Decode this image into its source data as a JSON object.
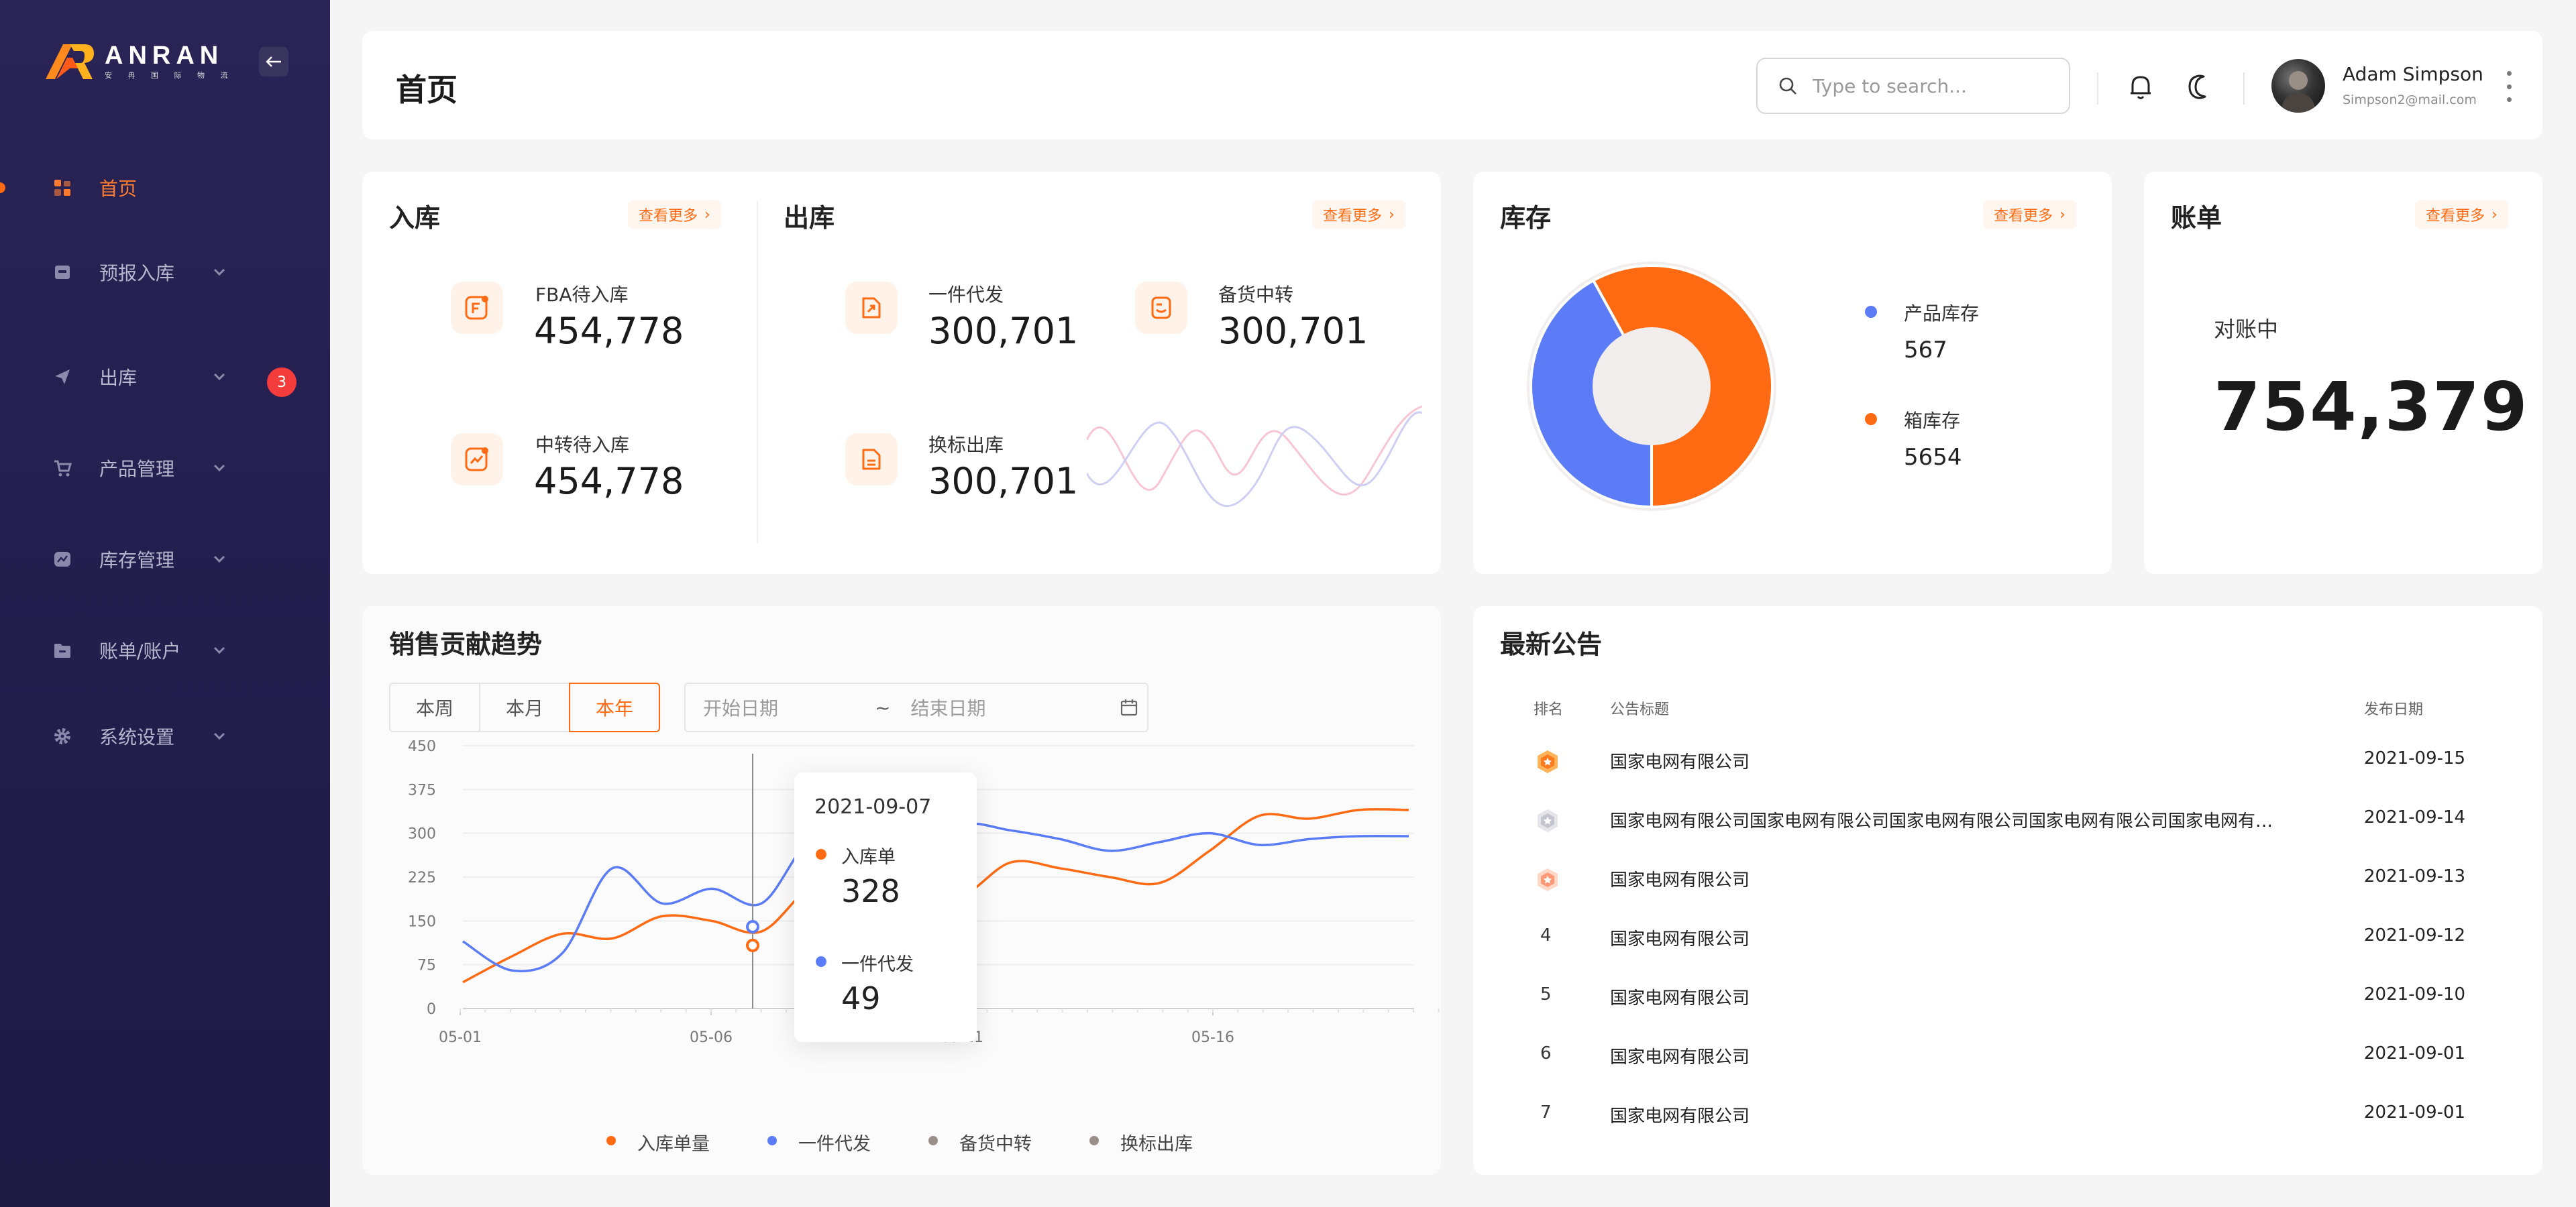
{
  "app": {
    "brand": "ANRAN",
    "brand_sub": "安 冉 国 际 物 流"
  },
  "sidebar": {
    "items": [
      {
        "label": "首页",
        "icon": "dashboard-icon",
        "active": true
      },
      {
        "label": "预报入库",
        "icon": "inbox-icon"
      },
      {
        "label": "出库",
        "icon": "send-icon",
        "badge": "3"
      },
      {
        "label": "产品管理",
        "icon": "cart-icon"
      },
      {
        "label": "库存管理",
        "icon": "chart-box-icon"
      },
      {
        "label": "账单/账户",
        "icon": "folder-icon"
      },
      {
        "label": "系统设置",
        "icon": "gear-icon"
      }
    ]
  },
  "header": {
    "title": "首页",
    "search_placeholder": "Type to search...",
    "user": {
      "name": "Adam Simpson",
      "email": "Simpson2@mail.com"
    }
  },
  "inbound": {
    "title": "入库",
    "more": "查看更多",
    "stats": [
      {
        "label": "FBA待入库",
        "value": "454,778"
      },
      {
        "label": "中转待入库",
        "value": "454,778"
      }
    ]
  },
  "outbound": {
    "title": "出库",
    "more": "查看更多",
    "stats": [
      {
        "label": "一件代发",
        "value": "300,701"
      },
      {
        "label": "备货中转",
        "value": "300,701"
      },
      {
        "label": "换标出库",
        "value": "300,701"
      }
    ]
  },
  "inventory": {
    "title": "库存",
    "more": "查看更多",
    "legend": [
      {
        "label": "产品库存",
        "value": "567",
        "color": "#5b7cf6"
      },
      {
        "label": "箱库存",
        "value": "5654",
        "color": "#ff6a13"
      }
    ]
  },
  "billing": {
    "title": "账单",
    "more": "查看更多",
    "label": "对账中",
    "value": "754,379"
  },
  "sales": {
    "title": "销售贡献趋势",
    "tabs": [
      "本周",
      "本月",
      "本年"
    ],
    "active_tab": "本年",
    "start_placeholder": "开始日期",
    "separator": "~",
    "end_placeholder": "结束日期",
    "tooltip": {
      "date": "2021-09-07",
      "items": [
        {
          "label": "入库单",
          "value": "328",
          "color": "#ff6a13"
        },
        {
          "label": "一件代发",
          "value": "49",
          "color": "#5b7cf6"
        }
      ]
    },
    "legend": [
      {
        "label": "入库单量",
        "color": "#ff6a13"
      },
      {
        "label": "一件代发",
        "color": "#5b7cf6"
      },
      {
        "label": "备货中转",
        "color": "#9a8e8a"
      },
      {
        "label": "换标出库",
        "color": "#9a8e8a"
      }
    ]
  },
  "chart_data": [
    {
      "type": "pie",
      "title": "",
      "categories": [
        "产品库存",
        "箱库存"
      ],
      "values": [
        567,
        5654
      ],
      "colors": [
        "#5b7cf6",
        "#ff6a13"
      ],
      "note": "donut"
    },
    {
      "type": "line",
      "title": "",
      "xlabel": "",
      "ylabel": "",
      "ylim": [
        0,
        450
      ],
      "yticks": [
        0,
        75,
        150,
        225,
        300,
        375,
        450
      ],
      "xticks": [
        "05-01",
        "05-06",
        "05-11",
        "05-16"
      ],
      "x": [
        0,
        1,
        2,
        3,
        4,
        5,
        6,
        7,
        8,
        9,
        10,
        11,
        12,
        13,
        14,
        15,
        16,
        17,
        18,
        19
      ],
      "series": [
        {
          "name": "入库单量",
          "color": "#ff6a13",
          "values": [
            45,
            90,
            128,
            120,
            158,
            150,
            132,
            210,
            235,
            200,
            192,
            250,
            240,
            225,
            215,
            270,
            330,
            325,
            340,
            340
          ]
        },
        {
          "name": "一件代发",
          "color": "#5b7cf6",
          "values": [
            115,
            65,
            95,
            240,
            180,
            205,
            180,
            290,
            280,
            265,
            315,
            305,
            290,
            270,
            285,
            300,
            280,
            290,
            295,
            295
          ]
        }
      ],
      "grid": true,
      "legend": "bottom"
    }
  ],
  "announcements": {
    "title": "最新公告",
    "columns": [
      "排名",
      "公告标题",
      "发布日期"
    ],
    "rows": [
      {
        "rank": "1",
        "title": "国家电网有限公司",
        "date": "2021-09-15",
        "medal": "gold"
      },
      {
        "rank": "2",
        "title": "国家电网有限公司国家电网有限公司国家电网有限公司国家电网有限公司国家电网有…",
        "date": "2021-09-14",
        "medal": "silver"
      },
      {
        "rank": "3",
        "title": "国家电网有限公司",
        "date": "2021-09-13",
        "medal": "bronze"
      },
      {
        "rank": "4",
        "title": "国家电网有限公司",
        "date": "2021-09-12"
      },
      {
        "rank": "5",
        "title": "国家电网有限公司",
        "date": "2021-09-10"
      },
      {
        "rank": "6",
        "title": "国家电网有限公司",
        "date": "2021-09-01"
      },
      {
        "rank": "7",
        "title": "国家电网有限公司",
        "date": "2021-09-01"
      }
    ]
  }
}
